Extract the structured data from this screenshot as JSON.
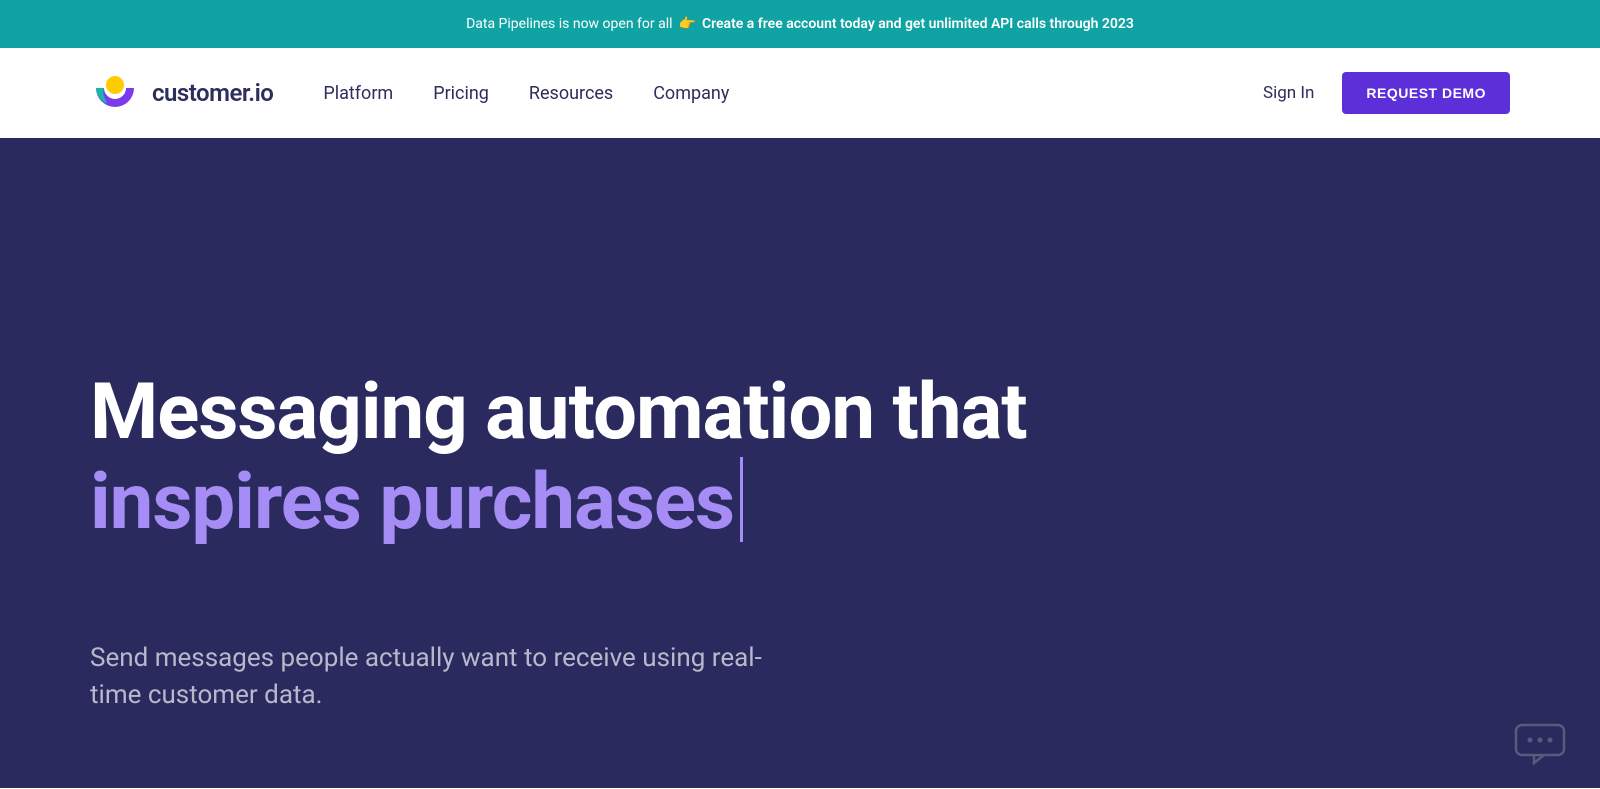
{
  "announcement": {
    "text1": "Data Pipelines is now open for all",
    "emoji": "👉",
    "text2": "Create a free account today and get unlimited API calls through 2023"
  },
  "logo": {
    "text": "customer.io"
  },
  "nav": {
    "items": [
      "Platform",
      "Pricing",
      "Resources",
      "Company"
    ]
  },
  "header": {
    "signin": "Sign In",
    "demo": "REQUEST DEMO"
  },
  "hero": {
    "title_line1": "Messaging automation that",
    "title_line2": "inspires purchases",
    "subtitle": "Send messages people actually want to receive using real-time customer data."
  }
}
